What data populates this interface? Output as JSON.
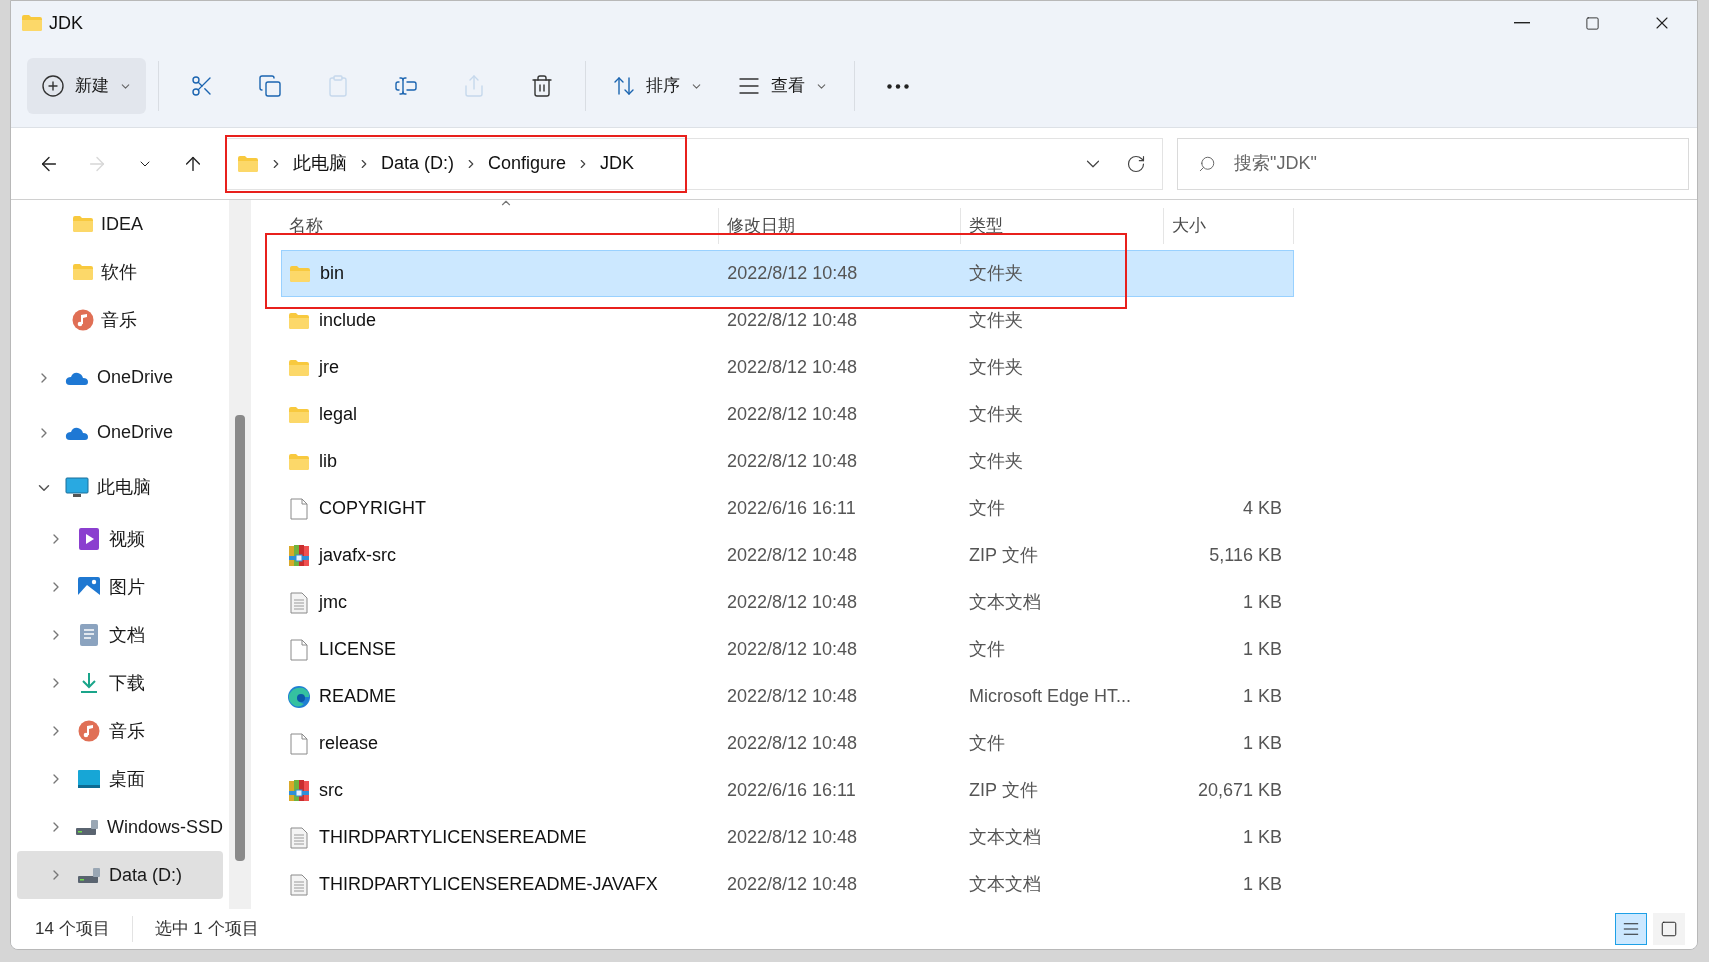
{
  "window": {
    "title": "JDK"
  },
  "toolbar": [
    {
      "kind": "new",
      "label": "新建",
      "disabled": false
    },
    {
      "kind": "cut",
      "disabled": false
    },
    {
      "kind": "copy",
      "disabled": false
    },
    {
      "kind": "paste",
      "disabled": true
    },
    {
      "kind": "rename",
      "disabled": false
    },
    {
      "kind": "share",
      "disabled": true
    },
    {
      "kind": "delete",
      "disabled": false
    },
    {
      "kind": "sort",
      "label": "排序",
      "disabled": false
    },
    {
      "kind": "view",
      "label": "查看",
      "disabled": false
    },
    {
      "kind": "more",
      "disabled": false
    }
  ],
  "nav": [
    {
      "kind": "back",
      "disabled": false
    },
    {
      "kind": "forward",
      "disabled": true
    },
    {
      "kind": "recent",
      "disabled": false
    },
    {
      "kind": "up",
      "disabled": false
    }
  ],
  "address_bar": {
    "highlighted": true,
    "crumbs": [
      "此电脑",
      "Data (D:)",
      "Configure",
      "JDK"
    ]
  },
  "search": {
    "placeholder": "搜索\"JDK\""
  },
  "sidebar": {
    "pinned": [
      {
        "kind": "folder",
        "label": "IDEA"
      },
      {
        "kind": "folder",
        "label": "软件"
      },
      {
        "kind": "music",
        "label": "音乐"
      }
    ],
    "tree": [
      {
        "kind": "cloud",
        "label": "OneDrive",
        "expanded": false,
        "selected": false
      },
      {
        "kind": "cloud",
        "label": "OneDrive",
        "expanded": false,
        "selected": false
      },
      {
        "kind": "pc",
        "label": "此电脑",
        "expanded": true,
        "selected": false,
        "children": [
          {
            "kind": "video",
            "label": "视频",
            "expanded": false,
            "selected": false
          },
          {
            "kind": "pictures",
            "label": "图片",
            "expanded": false,
            "selected": false
          },
          {
            "kind": "documents",
            "label": "文档",
            "expanded": false,
            "selected": false
          },
          {
            "kind": "downloads",
            "label": "下载",
            "expanded": false,
            "selected": false
          },
          {
            "kind": "music",
            "label": "音乐",
            "expanded": false,
            "selected": false
          },
          {
            "kind": "desktop",
            "label": "桌面",
            "expanded": false,
            "selected": false
          },
          {
            "kind": "drive",
            "label": "Windows-SSD",
            "expanded": false,
            "selected": false
          },
          {
            "kind": "drive",
            "label": "Data (D:)",
            "expanded": false,
            "selected": true
          }
        ]
      }
    ]
  },
  "table": {
    "columns": [
      "名称",
      "修改日期",
      "类型",
      "大小"
    ],
    "rows": [
      {
        "kind": "folder",
        "name": "bin",
        "date": "2022/8/12 10:48",
        "type": "文件夹",
        "selected": true,
        "highlighted": true
      },
      {
        "kind": "folder",
        "name": "include",
        "date": "2022/8/12 10:48",
        "type": "文件夹",
        "selected": false,
        "highlighted": false
      },
      {
        "kind": "folder",
        "name": "jre",
        "date": "2022/8/12 10:48",
        "type": "文件夹",
        "selected": false,
        "highlighted": false
      },
      {
        "kind": "folder",
        "name": "legal",
        "date": "2022/8/12 10:48",
        "type": "文件夹",
        "selected": false,
        "highlighted": false
      },
      {
        "kind": "folder",
        "name": "lib",
        "date": "2022/8/12 10:48",
        "type": "文件夹",
        "selected": false,
        "highlighted": false
      },
      {
        "kind": "file",
        "name": "COPYRIGHT",
        "date": "2022/6/16 16:11",
        "type": "文件",
        "size": "4 KB",
        "selected": false,
        "highlighted": false
      },
      {
        "kind": "zip",
        "name": "javafx-src",
        "date": "2022/8/12 10:48",
        "type": "ZIP 文件",
        "size": "5,116 KB",
        "selected": false,
        "highlighted": false
      },
      {
        "kind": "text",
        "name": "jmc",
        "date": "2022/8/12 10:48",
        "type": "文本文档",
        "size": "1 KB",
        "selected": false,
        "highlighted": false
      },
      {
        "kind": "file",
        "name": "LICENSE",
        "date": "2022/8/12 10:48",
        "type": "文件",
        "size": "1 KB",
        "selected": false,
        "highlighted": false
      },
      {
        "kind": "edge",
        "name": "README",
        "date": "2022/8/12 10:48",
        "type": "Microsoft Edge HT...",
        "size": "1 KB",
        "selected": false,
        "highlighted": false
      },
      {
        "kind": "file",
        "name": "release",
        "date": "2022/8/12 10:48",
        "type": "文件",
        "size": "1 KB",
        "selected": false,
        "highlighted": false
      },
      {
        "kind": "zip",
        "name": "src",
        "date": "2022/6/16 16:11",
        "type": "ZIP 文件",
        "size": "20,671 KB",
        "selected": false,
        "highlighted": false
      },
      {
        "kind": "text",
        "name": "THIRDPARTYLICENSEREADME",
        "date": "2022/8/12 10:48",
        "type": "文本文档",
        "size": "1 KB",
        "selected": false,
        "highlighted": false
      },
      {
        "kind": "text",
        "name": "THIRDPARTYLICENSEREADME-JAVAFX",
        "date": "2022/8/12 10:48",
        "type": "文本文档",
        "size": "1 KB",
        "selected": false,
        "highlighted": false
      }
    ]
  },
  "status_bar": {
    "items": [
      "14 个项目",
      "选中 1 个项目"
    ],
    "views": [
      {
        "kind": "details",
        "selected": true
      },
      {
        "kind": "tiles",
        "selected": false
      }
    ]
  }
}
